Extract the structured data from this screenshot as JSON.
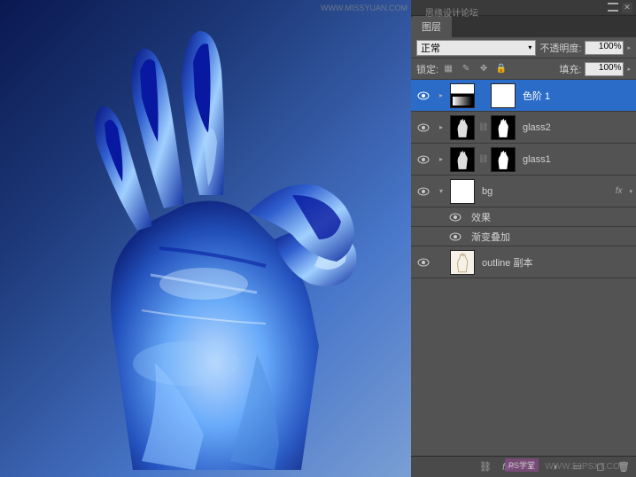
{
  "watermarks": {
    "top_right": "WWW.MISSYUAN.COM",
    "panel_title": "思缘设计论坛",
    "bottom_right": "WWW.52PSXT.COM",
    "bottom_badge": "PS学堂"
  },
  "panel": {
    "tab": "图层",
    "blend_mode": "正常",
    "opacity_label": "不透明度:",
    "opacity_value": "100%",
    "lock_label": "锁定:",
    "fill_label": "填充:",
    "fill_value": "100%"
  },
  "layers": [
    {
      "name": "色阶 1",
      "type": "adjustment",
      "selected": true,
      "visible": true
    },
    {
      "name": "glass2",
      "type": "masked",
      "selected": false,
      "visible": true
    },
    {
      "name": "glass1",
      "type": "masked",
      "selected": false,
      "visible": true
    },
    {
      "name": "bg",
      "type": "plain",
      "selected": false,
      "visible": true,
      "fx": true
    },
    {
      "name": "outline 副本",
      "type": "outline",
      "selected": false,
      "visible": true
    }
  ],
  "effects": {
    "header": "效果",
    "item": "渐变叠加"
  },
  "fx_label": "fx"
}
